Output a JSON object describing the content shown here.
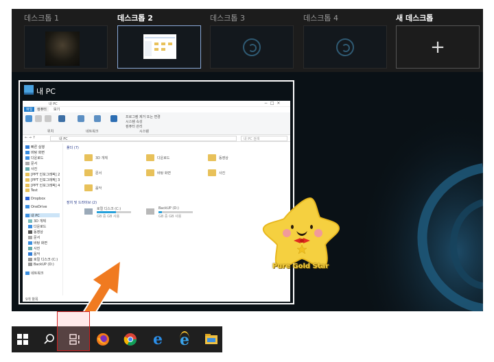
{
  "desktops": [
    {
      "label": "데스크톱 1",
      "active": false
    },
    {
      "label": "데스크톱 2",
      "active": true
    },
    {
      "label": "데스크톱 3",
      "active": false
    },
    {
      "label": "데스크톱 4",
      "active": false
    },
    {
      "label": "새 데스크톱",
      "active": false,
      "icon": "plus-icon"
    }
  ],
  "window": {
    "title": "내 PC",
    "explorer": {
      "title_small": "내 PC",
      "tabs": [
        "파일",
        "컴퓨터",
        "보기"
      ],
      "ribbon_groups": [
        "위치",
        "네트워크",
        "시스템"
      ],
      "ribbon_items": [
        "프로그램 제거 또는 변경",
        "시스템 속성",
        "컴퓨터 관리"
      ],
      "address": "내 PC",
      "search_placeholder": "내 PC 검색",
      "sidebar": [
        "빠른 실행",
        "바탕 화면",
        "다운로드",
        "문서",
        "사진",
        "[PPT 인포그래픽] 2",
        "[PPT 인포그래픽] 3",
        "[PPT 인포그래픽] 4",
        "Test",
        "Dropbox",
        "OneDrive",
        "내 PC",
        "3D 개체",
        "다운로드",
        "동영상",
        "문서",
        "바탕 화면",
        "사진",
        "음악",
        "로컬 디스크 (C:)",
        "BackUP (D:)",
        "네트워크"
      ],
      "section_folders": "폴더 (7)",
      "folders": [
        "3D 개체",
        "다운로드",
        "동영상",
        "문서",
        "바탕 화면",
        "사진",
        "음악"
      ],
      "section_drives": "장치 및 드라이브 (2)",
      "drives": [
        {
          "name": "로컬 디스크 (C:)",
          "info": "GB 중 GB 사용",
          "fill": 0.55
        },
        {
          "name": "BackUP (D:)",
          "info": "GB 중 GB 사용",
          "fill": 0.1
        }
      ],
      "status": "9개 항목"
    }
  },
  "sticker_text": "Pure Gold Star",
  "taskbar": {
    "items": [
      "start-icon",
      "search-icon",
      "task-view-icon",
      "firefox-icon",
      "chrome-icon",
      "edge-icon",
      "ie-icon",
      "file-explorer-icon"
    ]
  },
  "colors": {
    "accent": "#f07a20",
    "highlight": "#d02020",
    "star": "#f5d040"
  }
}
